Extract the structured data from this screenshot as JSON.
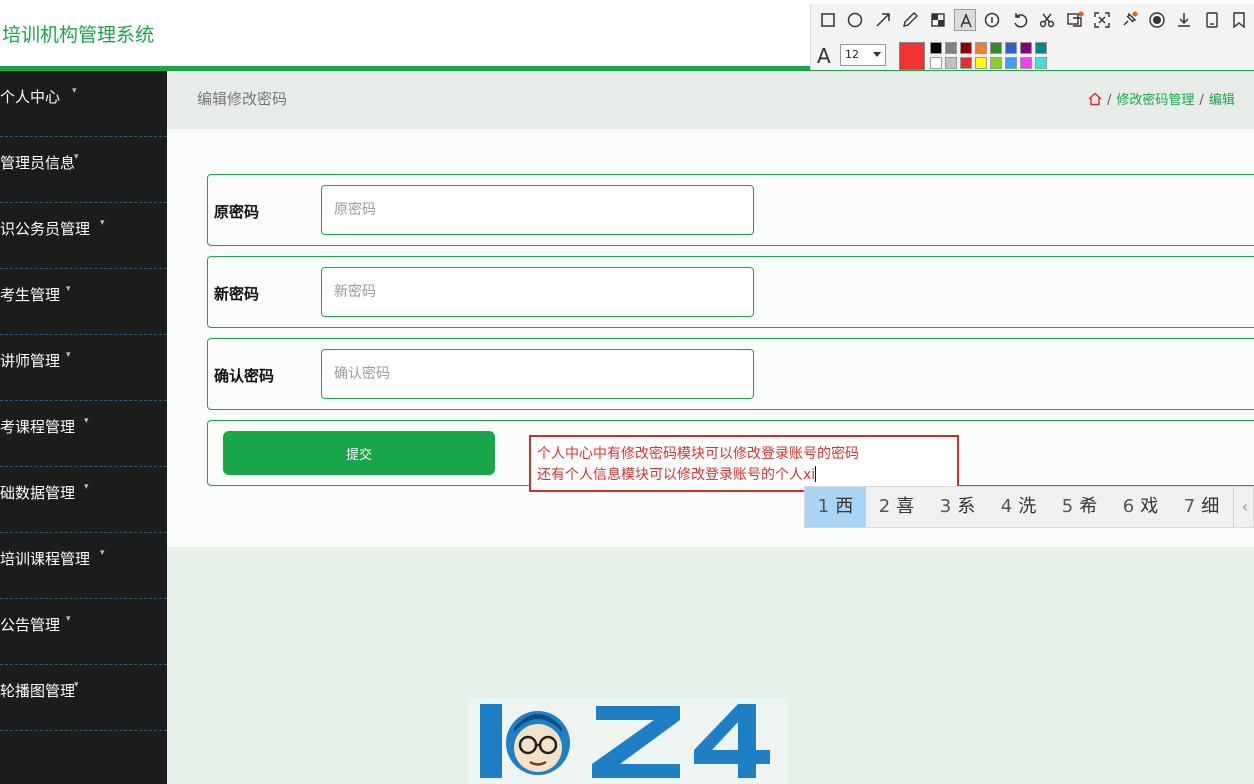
{
  "app": {
    "title": "培训机构管理系统"
  },
  "sidebar": {
    "items": [
      {
        "label": "个人中心"
      },
      {
        "label": "管理员信息"
      },
      {
        "label": "识公务员管理"
      },
      {
        "label": "考生管理"
      },
      {
        "label": "讲师管理"
      },
      {
        "label": "考课程管理"
      },
      {
        "label": "础数据管理"
      },
      {
        "label": "培训课程管理"
      },
      {
        "label": "公告管理"
      },
      {
        "label": "轮播图管理"
      }
    ]
  },
  "header": {
    "page_title": "编辑修改密码",
    "breadcrumb": [
      "修改密码管理",
      "编辑"
    ],
    "separator": "/"
  },
  "form": {
    "fields": [
      {
        "label": "原密码",
        "placeholder": "原密码",
        "value": ""
      },
      {
        "label": "新密码",
        "placeholder": "新密码",
        "value": ""
      },
      {
        "label": "确认密码",
        "placeholder": "确认密码",
        "value": ""
      }
    ],
    "submit_label": "提交"
  },
  "annotation": {
    "line1": "个人中心中有修改密码模块可以修改登录账号的密码",
    "line2": "还有个人信息模块可以修改登录账号的个人xi",
    "color": "#e0302c"
  },
  "ime": {
    "candidates": [
      {
        "num": "1",
        "char": "西"
      },
      {
        "num": "2",
        "char": "喜"
      },
      {
        "num": "3",
        "char": "系"
      },
      {
        "num": "4",
        "char": "洗"
      },
      {
        "num": "5",
        "char": "希"
      },
      {
        "num": "6",
        "char": "戏"
      },
      {
        "num": "7",
        "char": "细"
      }
    ],
    "prev": "‹",
    "selected_index": 0
  },
  "toolbar": {
    "font_size": "12",
    "font_glyph": "A",
    "current_color": "#ee3333",
    "tools": [
      "rectangle-icon",
      "ellipse-icon",
      "arrow-icon",
      "pencil-icon",
      "mosaic-icon",
      "text-icon",
      "number-icon",
      "undo-icon",
      "cut-icon",
      "translate-icon",
      "ocr-icon",
      "pin-icon",
      "record-icon",
      "download-icon",
      "save-icon",
      "bookmark-icon"
    ],
    "palette_row1": [
      "#000000",
      "#808080",
      "#8b0000",
      "#f08030",
      "#2e8b2e",
      "#3060d0",
      "#800080",
      "#008b8b"
    ],
    "palette_row2": [
      "#ffffff",
      "#c0c0c0",
      "#e03030",
      "#ffff00",
      "#90d020",
      "#40a0f0",
      "#f040f0",
      "#40e0e0"
    ]
  },
  "colors": {
    "accent": "#19a54a",
    "sidebar_bg": "#1b1c1b"
  }
}
